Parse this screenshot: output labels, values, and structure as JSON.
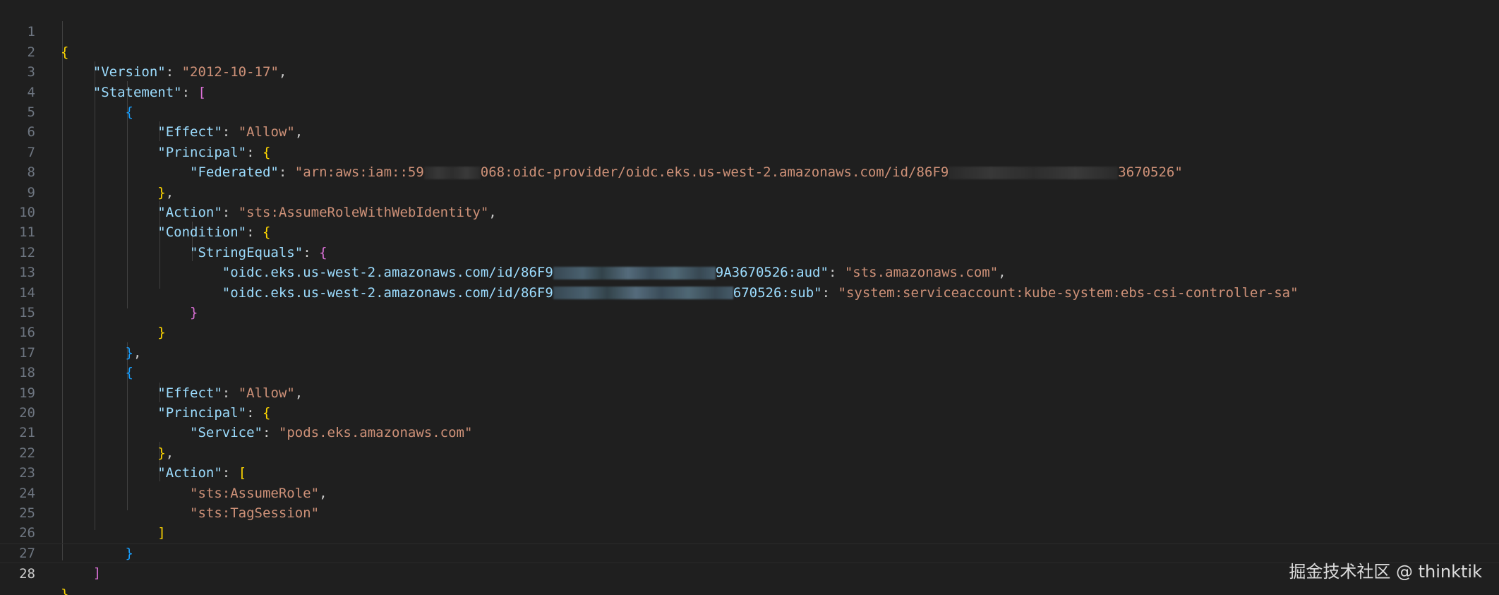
{
  "line_numbers": [
    "1",
    "2",
    "3",
    "4",
    "5",
    "6",
    "7",
    "8",
    "9",
    "10",
    "11",
    "12",
    "13",
    "14",
    "15",
    "16",
    "17",
    "18",
    "19",
    "20",
    "21",
    "22",
    "23",
    "24",
    "25",
    "26",
    "27",
    "28"
  ],
  "current_line": "28",
  "json": {
    "open_brace": "{",
    "close_brace": "}",
    "version_key": "\"Version\"",
    "version_value": "\"2012-10-17\"",
    "statement_key": "\"Statement\"",
    "open_bracket": "[",
    "close_bracket": "]",
    "effect_key": "\"Effect\"",
    "effect_value": "\"Allow\"",
    "principal_key": "\"Principal\"",
    "federated_key": "\"Federated\"",
    "federated_prefix": "\"arn:aws:iam::59",
    "federated_mid": "068:oidc-provider/oidc.eks.us-west-2.amazonaws.com/id/86F9",
    "federated_suffix": "3670526\"",
    "action_key": "\"Action\"",
    "action_value": "\"sts:AssumeRoleWithWebIdentity\"",
    "condition_key": "\"Condition\"",
    "stringequals_key": "\"StringEquals\"",
    "aud_key_prefix": "\"oidc.eks.us-west-2.amazonaws.com/id/86F9",
    "aud_key_suffix": "9A3670526:aud\"",
    "aud_value": "\"sts.amazonaws.com\"",
    "sub_key_prefix": "\"oidc.eks.us-west-2.amazonaws.com/id/86F9",
    "sub_key_suffix": "670526:sub\"",
    "sub_value": "\"system:serviceaccount:kube-system:ebs-csi-controller-sa\"",
    "service_key": "\"Service\"",
    "service_value": "\"pods.eks.amazonaws.com\"",
    "assume_role": "\"sts:AssumeRole\"",
    "tag_session": "\"sts:TagSession\""
  },
  "watermark": "掘金技术社区 @ thinktik",
  "colors": {
    "background": "#1f1f1f",
    "key": "#9cdcfe",
    "string": "#ce9178",
    "bracket_level1": "#ffd700",
    "bracket_level2": "#da70d6",
    "bracket_level3": "#179fff",
    "line_number": "#6e7681"
  }
}
